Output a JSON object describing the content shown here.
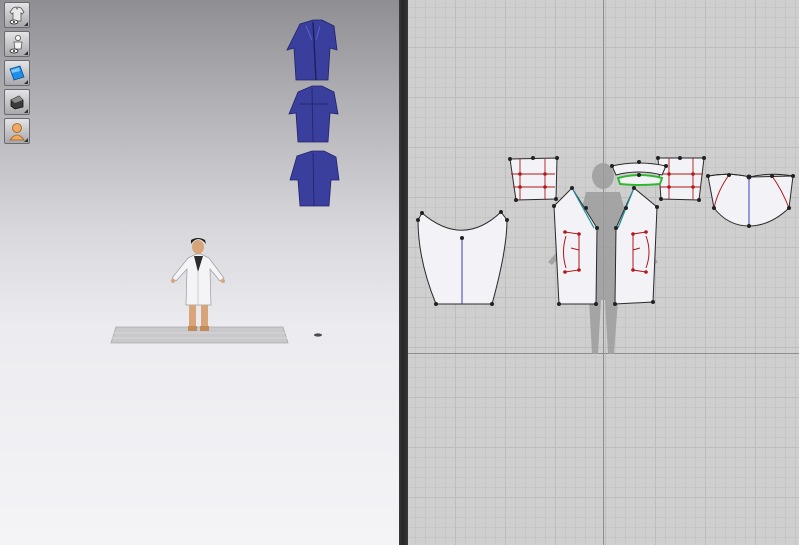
{
  "toolbar": {
    "buttons": [
      {
        "icon": "garment-visibility-icon"
      },
      {
        "icon": "avatar-visibility-icon"
      },
      {
        "icon": "texture-icon"
      },
      {
        "icon": "render-mode-icon"
      },
      {
        "icon": "avatar-skin-icon"
      }
    ]
  },
  "colors": {
    "garment_3d": "#3a3f9e",
    "pattern_fill": "#f2f2f7",
    "pattern_outline": "#2a2a2a",
    "seam_red": "#b0181b",
    "grain_line": "#3c3cc0",
    "selected_green": "#2fb82f",
    "teal_line": "#1a8f9a"
  }
}
